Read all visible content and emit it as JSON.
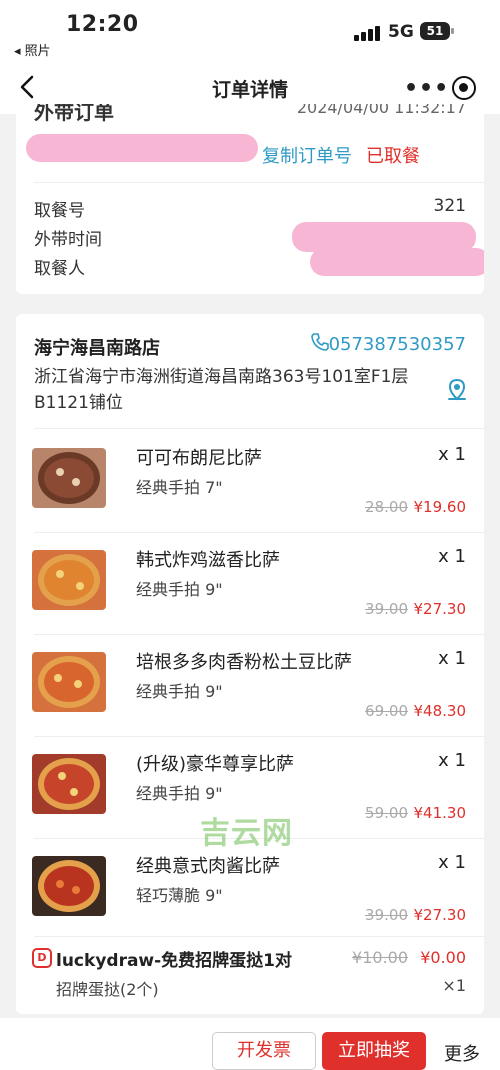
{
  "status_bar": {
    "time": "12:20",
    "back_app": "◂ 照片",
    "network": "5G",
    "battery": "51"
  },
  "nav": {
    "title": "订单详情",
    "more": "•••"
  },
  "order": {
    "partial_title": "外带订单",
    "partial_time": "2024/04/00 11:32:17",
    "copy_label": "复制订单号",
    "status": "已取餐",
    "rows": [
      {
        "label": "取餐号",
        "value": "321"
      },
      {
        "label": "外带时间",
        "value": ""
      },
      {
        "label": "取餐人",
        "value": ""
      }
    ]
  },
  "store": {
    "name": "海宁海昌南路店",
    "phone": "057387530357",
    "address": "浙江省海宁市海洲街道海昌南路363号101室F1层B1121铺位"
  },
  "items": [
    {
      "name": "可可布朗尼比萨",
      "spec": "经典手拍 7\"",
      "qty": "x 1",
      "old_price": "28.00",
      "price": "¥19.60"
    },
    {
      "name": "韩式炸鸡滋香比萨",
      "spec": "经典手拍 9\"",
      "qty": "x 1",
      "old_price": "39.00",
      "price": "¥27.30"
    },
    {
      "name": "培根多多肉香粉松土豆比萨",
      "spec": "经典手拍 9\"",
      "qty": "x 1",
      "old_price": "69.00",
      "price": "¥48.30"
    },
    {
      "name": "(升级)豪华尊享比萨",
      "spec": "经典手拍 9\"",
      "qty": "x 1",
      "old_price": "59.00",
      "price": "¥41.30"
    },
    {
      "name": "经典意式肉酱比萨",
      "spec": "轻巧薄脆 9\"",
      "qty": "x 1",
      "old_price": "39.00",
      "price": "¥27.30"
    }
  ],
  "promo": {
    "name": "luckydraw-免费招牌蛋挞1对",
    "old_price": "¥10.00",
    "price": "¥0.00",
    "sub": "招牌蛋挞(2个)",
    "qty": "×1"
  },
  "watermark": "吉云网",
  "bottom": {
    "invoice": "开发票",
    "draw": "立即抽奖",
    "more": "更多"
  }
}
